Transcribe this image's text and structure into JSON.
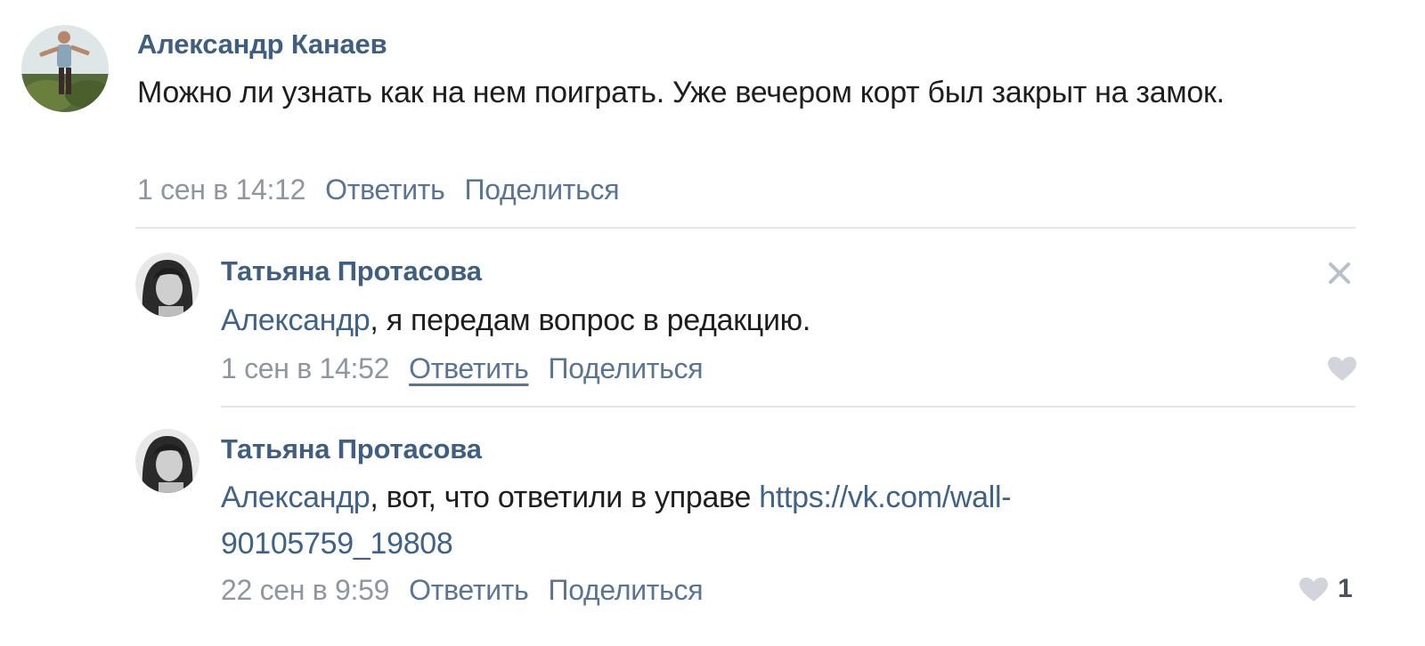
{
  "comments": [
    {
      "author": "Александр Канаев",
      "text": "Можно ли узнать как на нем поиграть. Уже вечером корт был закрыт на замок.",
      "date": "1 сен в 14:12",
      "reply_label": "Ответить",
      "share_label": "Поделиться"
    }
  ],
  "replies": [
    {
      "author": "Татьяна Протасова",
      "mention": "Александр",
      "text": ", я передам вопрос в редакцию.",
      "date": "1 сен в 14:52",
      "reply_label": "Ответить",
      "share_label": "Поделиться"
    },
    {
      "author": "Татьяна Протасова",
      "mention": "Александр",
      "text": ", вот, что ответили в управе ",
      "link": "https://vk.com/wall-90105759_19808",
      "date": "22 сен в 9:59",
      "reply_label": "Ответить",
      "share_label": "Поделиться",
      "likes": "1"
    }
  ],
  "icons": {
    "close": "close-icon",
    "like": "heart-icon"
  },
  "colors": {
    "author": "#3f5f82",
    "link": "#3f6289",
    "meta": "#8f96a0",
    "action": "#5a7494",
    "divider": "#e4e6ea"
  }
}
